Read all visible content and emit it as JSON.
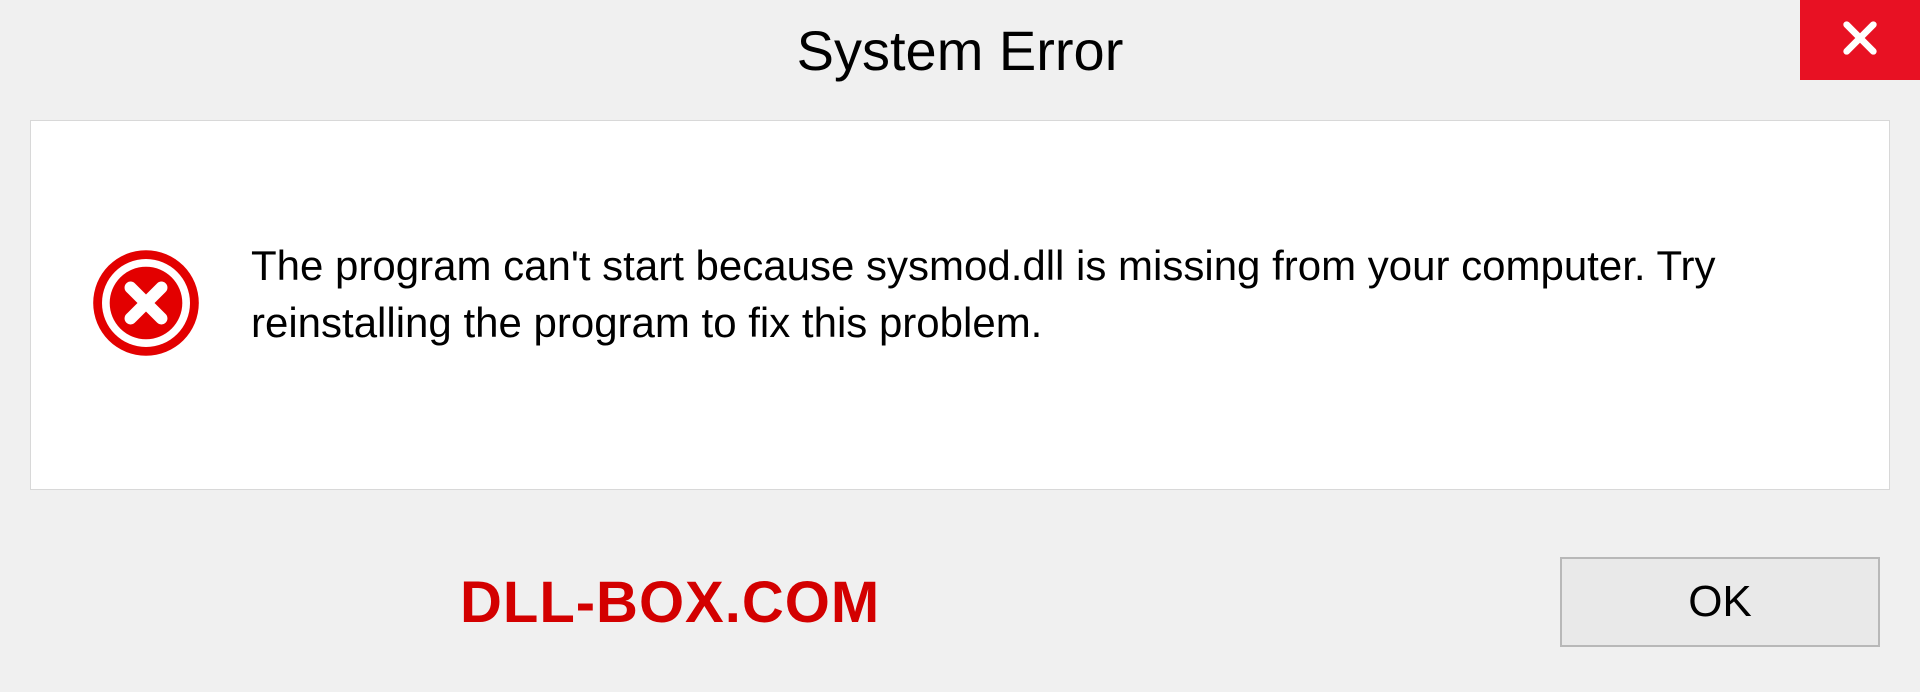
{
  "dialog": {
    "title": "System Error",
    "message": "The program can't start because sysmod.dll is missing from your computer. Try reinstalling the program to fix this problem.",
    "ok_label": "OK"
  },
  "watermark": "DLL-BOX.COM"
}
